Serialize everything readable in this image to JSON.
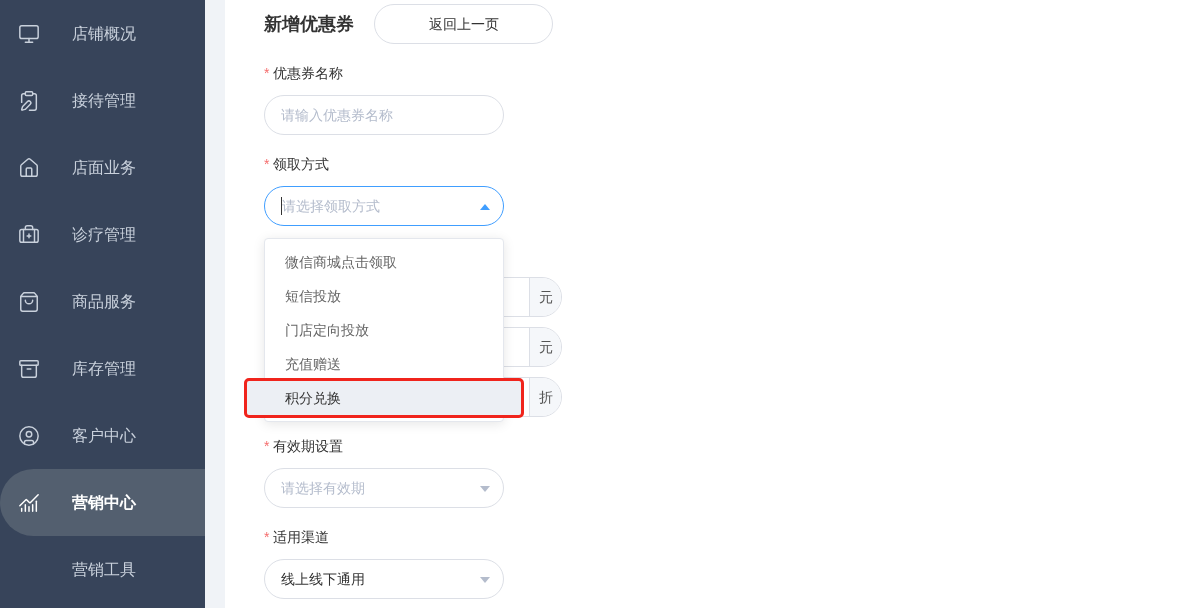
{
  "sidebar": {
    "items": [
      {
        "label": "店铺概况",
        "selected": false
      },
      {
        "label": "接待管理",
        "selected": false
      },
      {
        "label": "店面业务",
        "selected": false
      },
      {
        "label": "诊疗管理",
        "selected": false
      },
      {
        "label": "商品服务",
        "selected": false
      },
      {
        "label": "库存管理",
        "selected": false
      },
      {
        "label": "客户中心",
        "selected": false
      },
      {
        "label": "营销中心",
        "selected": true
      },
      {
        "label": "营销工具",
        "selected": false
      }
    ]
  },
  "page": {
    "title": "新增优惠券",
    "back_button": "返回上一页"
  },
  "form": {
    "name_field": {
      "label": "优惠券名称",
      "required_mark": "*",
      "placeholder": "请输入优惠券名称"
    },
    "method_field": {
      "label": "领取方式",
      "required_mark": "*",
      "placeholder": "请选择领取方式",
      "expanded": true,
      "options": [
        {
          "label": "微信商城点击领取",
          "selected": false,
          "annotated": false
        },
        {
          "label": "短信投放",
          "selected": false,
          "annotated": false
        },
        {
          "label": "门店定向投放",
          "selected": false,
          "annotated": false
        },
        {
          "label": "充值赠送",
          "selected": false,
          "annotated": false
        },
        {
          "label": "积分兑换",
          "selected": true,
          "annotated": true
        }
      ]
    },
    "covered_fields": [
      {
        "suffix": "元"
      },
      {
        "suffix": "元"
      },
      {
        "suffix": "折"
      }
    ],
    "validity_field": {
      "label": "有效期设置",
      "required_mark": "*",
      "placeholder": "请选择有效期",
      "expanded": false
    },
    "channel_field": {
      "label": "适用渠道",
      "required_mark": "*",
      "value": "线上线下通用",
      "expanded": false
    }
  }
}
